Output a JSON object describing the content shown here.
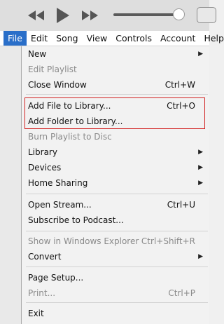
{
  "menubar": {
    "items": [
      "File",
      "Edit",
      "Song",
      "View",
      "Controls",
      "Account",
      "Help"
    ],
    "active": "File"
  },
  "file_menu": {
    "new": {
      "label": "New"
    },
    "edit_playlist": {
      "label": "Edit Playlist"
    },
    "close_window": {
      "label": "Close Window",
      "shortcut": "Ctrl+W"
    },
    "add_file": {
      "label": "Add File to Library...",
      "shortcut": "Ctrl+O"
    },
    "add_folder": {
      "label": "Add Folder to Library..."
    },
    "burn_playlist": {
      "label": "Burn Playlist to Disc"
    },
    "library": {
      "label": "Library"
    },
    "devices": {
      "label": "Devices"
    },
    "home_sharing": {
      "label": "Home Sharing"
    },
    "open_stream": {
      "label": "Open Stream...",
      "shortcut": "Ctrl+U"
    },
    "subscribe_podcast": {
      "label": "Subscribe to Podcast..."
    },
    "show_explorer": {
      "label": "Show in Windows Explorer",
      "shortcut": "Ctrl+Shift+R"
    },
    "convert": {
      "label": "Convert"
    },
    "page_setup": {
      "label": "Page Setup..."
    },
    "print": {
      "label": "Print...",
      "shortcut": "Ctrl+P"
    },
    "exit": {
      "label": "Exit"
    }
  },
  "colors": {
    "highlight_border": "#d22222",
    "menu_active_bg": "#2a6fc9",
    "disabled_text": "#8a8a8a"
  },
  "icons": [
    "previous-icon",
    "play-icon",
    "next-icon",
    "volume-slider",
    "airplay-icon",
    "submenu-arrow-icon"
  ],
  "volume": {
    "level": 0.9
  }
}
